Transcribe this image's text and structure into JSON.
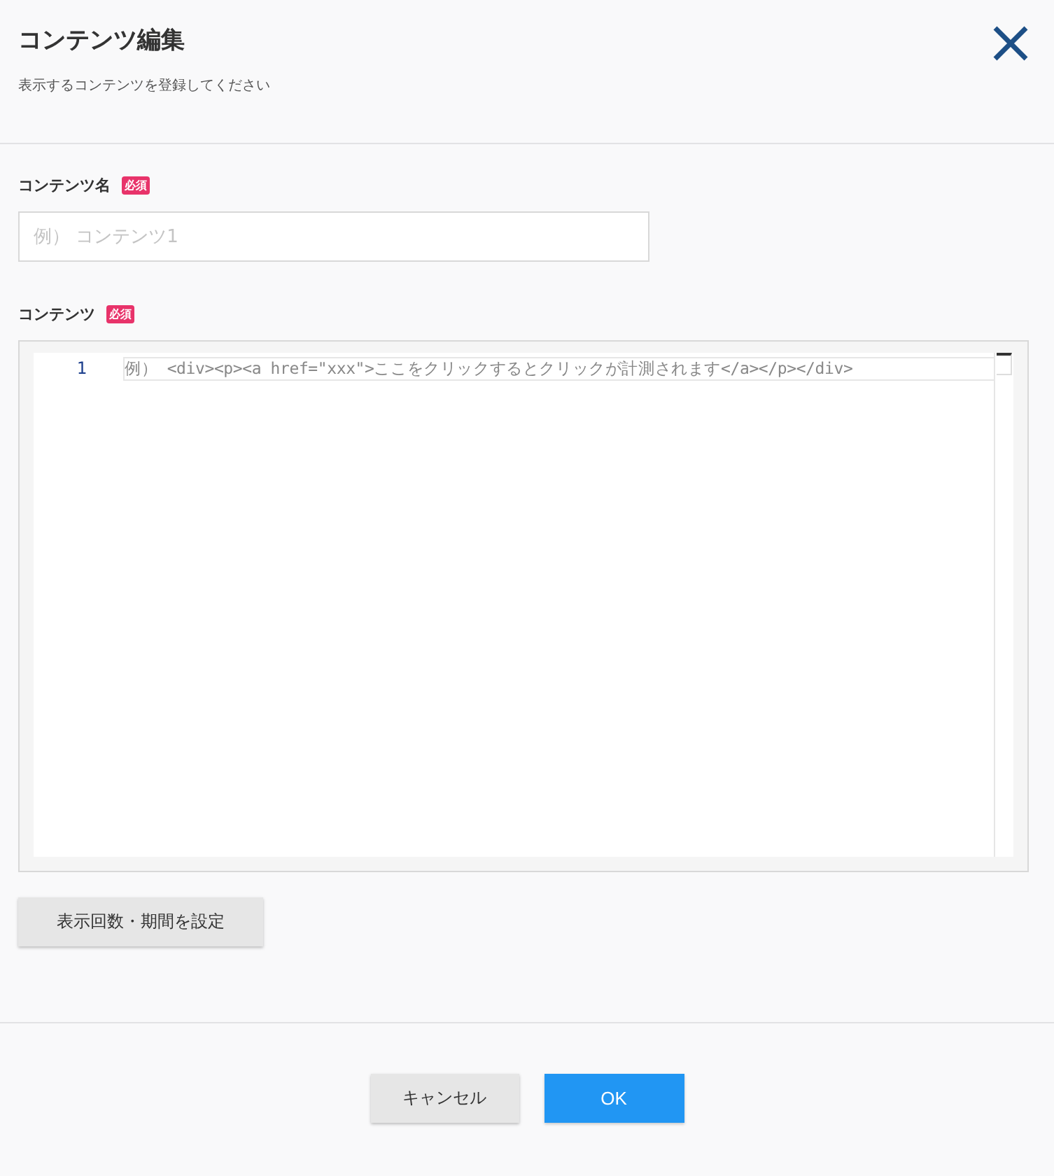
{
  "dialog": {
    "title": "コンテンツ編集",
    "subtitle": "表示するコンテンツを登録してください"
  },
  "name_field": {
    "label": "コンテンツ名",
    "badge": "必須",
    "placeholder": "例） コンテンツ1"
  },
  "content_field": {
    "label": "コンテンツ",
    "badge": "必須",
    "line_number": "1",
    "placeholder": "例） <div><p><a href=\"xxx\">ここをクリックするとクリックが計測されます</a></p></div>"
  },
  "settings_button": "表示回数・期間を設定",
  "buttons": [
    {
      "kind": "secondary",
      "label": "キャンセル"
    },
    {
      "kind": "primary",
      "label": "OK"
    }
  ]
}
